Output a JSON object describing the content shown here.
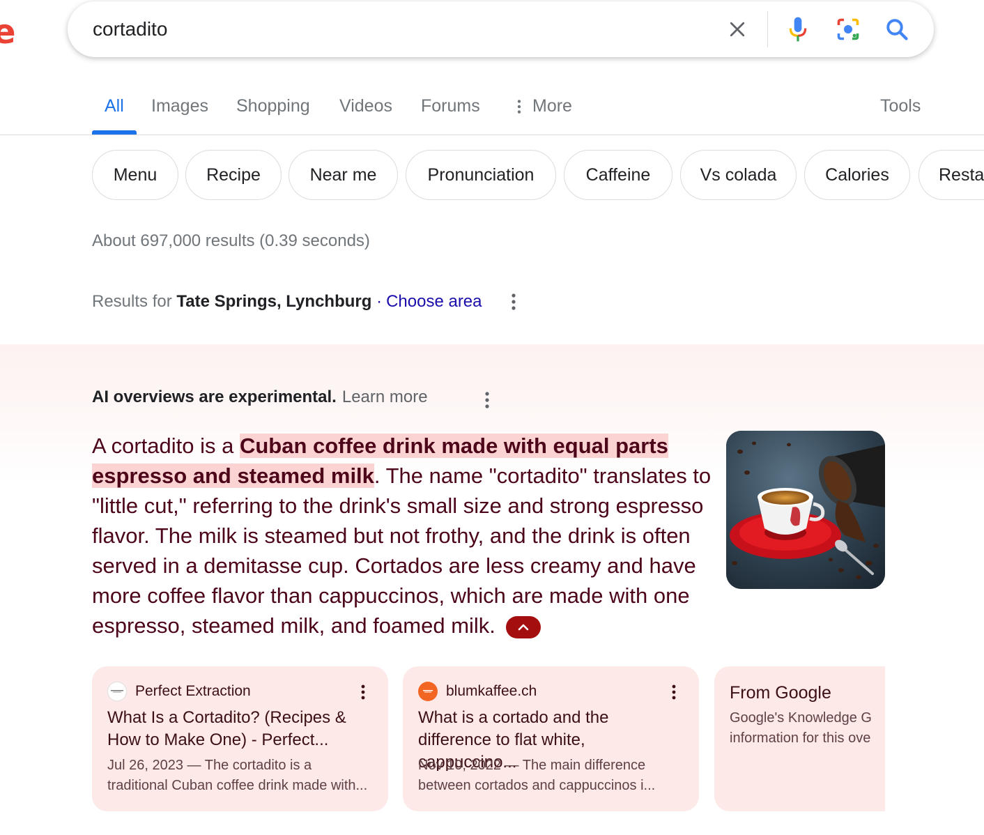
{
  "logo": {
    "fragment": "e"
  },
  "search": {
    "query": "cortadito",
    "icons": [
      "close-icon",
      "mic-icon",
      "lens-icon",
      "search-icon"
    ]
  },
  "tabs": {
    "items": [
      {
        "label": "All",
        "active": true
      },
      {
        "label": "Images"
      },
      {
        "label": "Shopping"
      },
      {
        "label": "Videos"
      },
      {
        "label": "Forums"
      },
      {
        "label": "More"
      }
    ],
    "tools": "Tools"
  },
  "chips": [
    "Menu",
    "Recipe",
    "Near me",
    "Pronunciation",
    "Caffeine",
    "Vs colada",
    "Calories",
    "Restau"
  ],
  "stats": "About 697,000 results (0.39 seconds)",
  "location": {
    "prefix": "Results for",
    "place": "Tate Springs, Lynchburg",
    "separator": "·",
    "action": "Choose area"
  },
  "ai_overview": {
    "notice": "AI overviews are experimental.",
    "learn_more": "Learn more",
    "text_intro": "A cortadito is a ",
    "text_highlight": "Cuban coffee drink made with equal parts espresso and steamed milk",
    "text_rest": ". The name \"cortadito\" translates to \"little cut,\" referring to the drink's small size and strong espresso flavor. The milk is steamed but not frothy, and the drink is often served in a demitasse cup. Cortados are less creamy and have more coffee flavor than cappuccinos, which are made with one espresso, steamed milk, and foamed milk.",
    "colors": {
      "text": "#4c0519",
      "highlight": "#fbd3d2",
      "button": "#a50e0e"
    }
  },
  "sources": [
    {
      "site": "Perfect Extraction",
      "title": "What Is a Cortadito? (Recipes & How to Make One) - Perfect...",
      "snippet": "Jul 26, 2023 — The cortadito is a traditional Cuban coffee drink made with..."
    },
    {
      "site": "blumkaffee.ch",
      "title": "What is a cortado and the difference to flat white, cappuccino...",
      "snippet": "Nov 10, 2022 — The main difference between cortados and cappuccinos i..."
    },
    {
      "site": "From Google",
      "desc": "Google's Knowledge G information for this ove"
    }
  ]
}
